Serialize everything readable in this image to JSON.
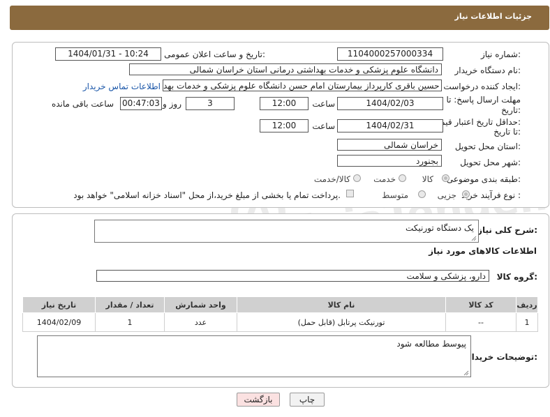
{
  "header": {
    "title": "جزئیات اطلاعات نیاز"
  },
  "form": {
    "need_number_label": "شماره نیاز:",
    "need_number": "1104000257000334",
    "announce_label": "تاریخ و ساعت اعلان عمومی:",
    "announce_value": "1404/01/31 - 10:24",
    "buyer_org_label": "نام دستگاه خریدار:",
    "buyer_org": "دانشگاه علوم پزشکی و خدمات بهداشتی درمانی استان خراسان شمالی",
    "creator_label": "ایجاد کننده درخواست:",
    "creator": "حسین باقری کارپرداز بیمارستان امام حسن دانشگاه علوم پزشکی و خدمات بهد",
    "contact_link": "اطلاعات تماس خریدار",
    "deadline_label_1": "مهلت ارسال پاسخ: تا",
    "deadline_label_2": "تاریخ:",
    "deadline_date": "1404/02/03",
    "time_label": "ساعت",
    "deadline_time": "12:00",
    "days_value": "3",
    "days_label": "روز و",
    "remaining_time": "00:47:03",
    "remaining_label": "ساعت باقی مانده",
    "validity_label_1": "حداقل تاریخ اعتبار قیمت:",
    "validity_label_2": "تا تاریخ:",
    "validity_date": "1404/02/31",
    "validity_time_label": "ساعت",
    "validity_time": "12:00",
    "province_label": "استان محل تحویل:",
    "province": "خراسان شمالی",
    "city_label": "شهر محل تحویل:",
    "city": "بجنورد",
    "category_label": "طبقه بندی موضوعی:",
    "category_options": [
      "کالا",
      "خدمت",
      "کالا/خدمت"
    ],
    "process_label": "نوع فرآیند خرید :",
    "process_options": [
      "جزیی",
      "متوسط"
    ],
    "payment_note": "پرداخت تمام یا بخشی از مبلغ خرید،از محل \"اسناد خزانه اسلامی\" خواهد بود."
  },
  "details": {
    "description_label": "شرح کلی نیاز:",
    "description": "یک دستگاه تورنیکت",
    "goods_info_title": "اطلاعات کالاهای مورد نیاز",
    "goods_group_label": "گروه کالا:",
    "goods_group": "دارو، پزشکی و سلامت",
    "table": {
      "headers": [
        "ردیف",
        "کد کالا",
        "نام کالا",
        "واحد شمارش",
        "تعداد / مقدار",
        "تاریخ نیاز"
      ],
      "rows": [
        [
          "1",
          "--",
          "تورنیکت پرتابل (قابل حمل)",
          "عدد",
          "1",
          "1404/02/09"
        ]
      ]
    },
    "buyer_notes_label": "توضیحات خریدار:",
    "buyer_notes": "پیوسط مطالعه شود"
  },
  "buttons": {
    "print": "چاپ",
    "back": "بازگشت"
  },
  "watermark": {
    "text": "AriaTender.net"
  },
  "colors": {
    "header_bg": "#8b6a3e",
    "link": "#1a56a8",
    "back_button_bg": "#fbe1e1"
  }
}
